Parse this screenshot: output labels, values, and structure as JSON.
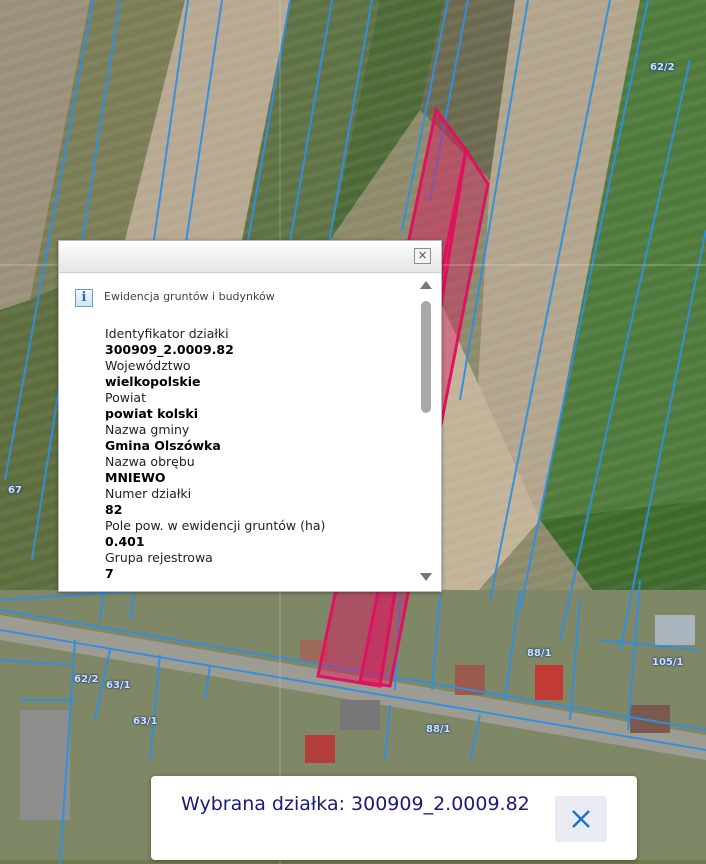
{
  "map": {
    "parcel_labels": [
      "62/2",
      "67",
      "62/2",
      "63/1",
      "63/1",
      "88/1",
      "88/1",
      "105/1"
    ]
  },
  "popup": {
    "layer_name": "Ewidencja gruntów i budynków",
    "close_glyph": "×",
    "info_glyph": "i",
    "attributes": [
      {
        "label": "Identyfikator działki",
        "value": "300909_2.0009.82"
      },
      {
        "label": "Województwo",
        "value": "wielkopolskie"
      },
      {
        "label": "Powiat",
        "value": "powiat kolski"
      },
      {
        "label": "Nazwa gminy",
        "value": "Gmina Olszówka"
      },
      {
        "label": "Nazwa obrębu",
        "value": "MNIEWO"
      },
      {
        "label": "Numer działki",
        "value": "82"
      },
      {
        "label": "Pole pow. w ewidencji gruntów (ha)",
        "value": "0.401"
      },
      {
        "label": "Grupa rejestrowa",
        "value": "7"
      }
    ]
  },
  "selection": {
    "text": "Wybrana działka: 300909_2.0009.82",
    "close_icon": "close-icon"
  },
  "colors": {
    "selected_parcel": "#e0115f",
    "parcel_lines": "#2f8fe6"
  }
}
